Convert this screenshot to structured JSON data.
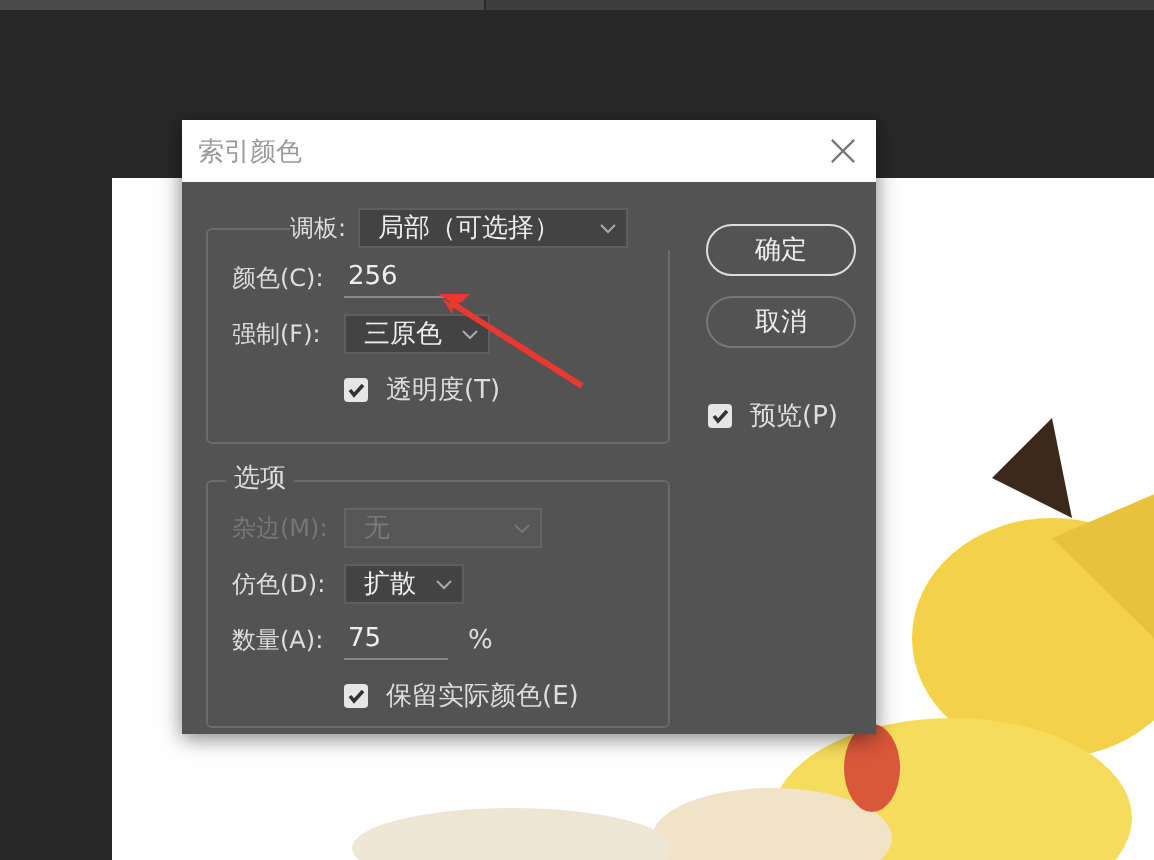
{
  "dialog": {
    "title": "索引颜色"
  },
  "palette": {
    "label": "调板:",
    "value": "局部（可选择）"
  },
  "colors": {
    "label": "颜色(C):",
    "value": "256"
  },
  "forced": {
    "label": "强制(F):",
    "value": "三原色"
  },
  "transparency": {
    "label": "透明度(T)",
    "checked": true
  },
  "options": {
    "title": "选项",
    "matte": {
      "label": "杂边(M):",
      "value": "无",
      "disabled": true
    },
    "dither": {
      "label": "仿色(D):",
      "value": "扩散",
      "disabled": false
    },
    "amount": {
      "label": "数量(A):",
      "value": "75",
      "unit": "%"
    },
    "preserve_exact_colors": {
      "label": "保留实际颜色(E)",
      "checked": true
    }
  },
  "buttons": [
    {
      "label": "确定",
      "default": true
    },
    {
      "label": "取消",
      "default": false
    }
  ],
  "preview": {
    "label": "预览(P)",
    "checked": true
  }
}
